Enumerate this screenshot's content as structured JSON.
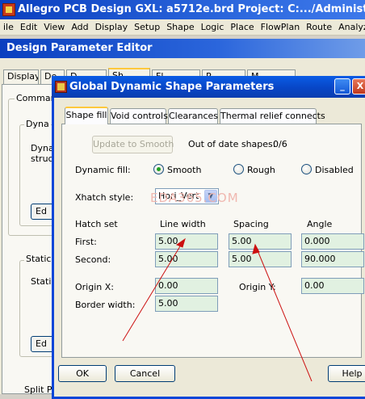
{
  "app": {
    "title": "Allegro PCB Design GXL: a5712e.brd  Project: C:.../Administrator/桌面"
  },
  "menubar": [
    "ile",
    "Edit",
    "View",
    "Add",
    "Display",
    "Setup",
    "Shape",
    "Logic",
    "Place",
    "FlowPlan",
    "Route",
    "Analyze"
  ],
  "design_parameter_editor": {
    "title": "Design Parameter Editor",
    "tabs": [
      "Display",
      "De",
      "D",
      "Sh",
      "Fl",
      "R",
      "M"
    ],
    "command_group": "Comman",
    "dynamic_group": "Dyna",
    "dynamic_text": "Dyna",
    "dynamic_text2": "struc",
    "edit_button": "Ed",
    "static_group": "Static",
    "static_text": "Stati",
    "edit_button2": "Ed",
    "split_group": "Split P"
  },
  "dialog": {
    "title": "Global Dynamic Shape Parameters",
    "minimize_glyph": "_",
    "close_glyph": "X",
    "tabs": [
      "Shape fill",
      "Void controls",
      "Clearances",
      "Thermal relief connects"
    ],
    "update_button": "Update to Smooth",
    "out_of_date_label": "Out of date shapes:",
    "out_of_date_value": "0/6",
    "dynamic_fill_label": "Dynamic fill:",
    "fill_options": [
      "Smooth",
      "Rough",
      "Disabled"
    ],
    "fill_selected": "Smooth",
    "xhatch_label": "Xhatch style:",
    "xhatch_value": "Hori_Vert",
    "watermark": "EDA365.COM",
    "hatch_set_label": "Hatch set",
    "columns": [
      "Line width",
      "Spacing",
      "Angle"
    ],
    "rows": [
      {
        "label": "First:",
        "line_width": "5.00",
        "spacing": "5.00",
        "angle": "0.000"
      },
      {
        "label": "Second:",
        "line_width": "5.00",
        "spacing": "5.00",
        "angle": "90.000"
      }
    ],
    "origin_x_label": "Origin X:",
    "origin_x_value": "0.00",
    "origin_y_label": "Origin Y:",
    "origin_y_value": "0.00",
    "border_width_label": "Border width:",
    "border_width_value": "5.00",
    "ok_button": "OK",
    "cancel_button": "Cancel",
    "help_button": "Help"
  },
  "colors": {
    "titlebar_blue": "#0a46d8",
    "field_green": "#e1f1e1",
    "annotation_red": "#cc1010",
    "active_tab_accent": "#ffc83c"
  }
}
